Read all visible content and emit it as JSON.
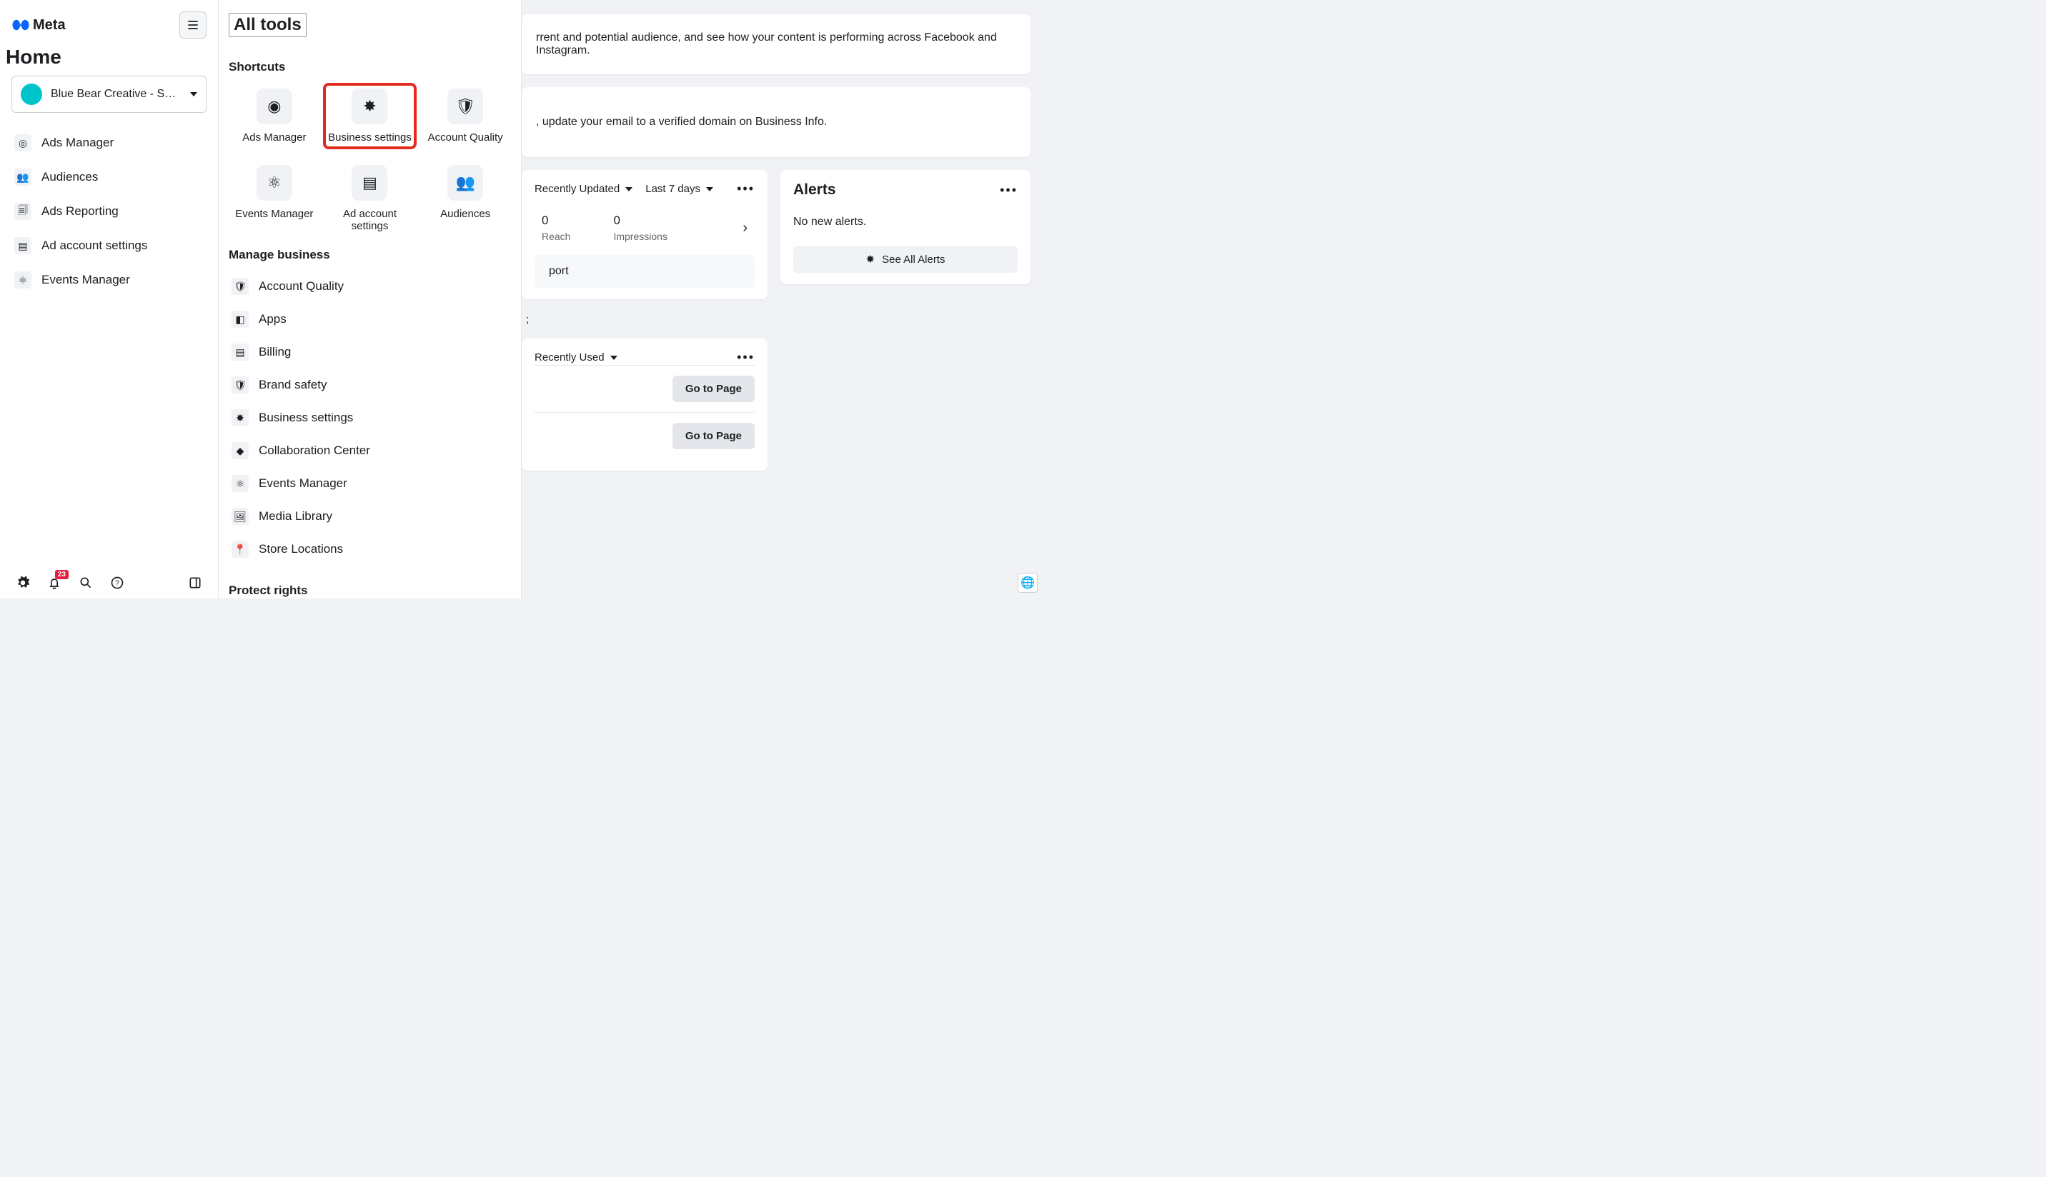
{
  "sidebar": {
    "logo_text": "Meta",
    "home_title": "Home",
    "account_name": "Blue Bear Creative - Soc...",
    "nav": [
      {
        "label": "Ads Manager"
      },
      {
        "label": "Audiences"
      },
      {
        "label": "Ads Reporting"
      },
      {
        "label": "Ad account settings"
      },
      {
        "label": "Events Manager"
      }
    ],
    "notification_count": "23"
  },
  "all_tools": {
    "title": "All tools",
    "shortcuts_heading": "Shortcuts",
    "shortcuts": [
      {
        "label": "Ads Manager"
      },
      {
        "label": "Business settings"
      },
      {
        "label": "Account Quality"
      },
      {
        "label": "Events Manager"
      },
      {
        "label": "Ad account settings"
      },
      {
        "label": "Audiences"
      }
    ],
    "manage_heading": "Manage business",
    "manage_items": [
      {
        "label": "Account Quality"
      },
      {
        "label": "Apps"
      },
      {
        "label": "Billing"
      },
      {
        "label": "Brand safety"
      },
      {
        "label": "Business settings"
      },
      {
        "label": "Collaboration Center"
      },
      {
        "label": "Events Manager"
      },
      {
        "label": "Media Library"
      },
      {
        "label": "Store Locations"
      }
    ],
    "protect_heading": "Protect rights"
  },
  "main": {
    "banner1_text": "rrent and potential audience, and see how your content is performing across Facebook and Instagram.",
    "banner2_text": ", update your email to a verified domain on Business Info.",
    "stats_card": {
      "filter1": "Recently Updated",
      "filter2": "Last 7 days",
      "reach_value": "0",
      "reach_label": "Reach",
      "impressions_value": "0",
      "impressions_label": "Impressions",
      "port_label": "port"
    },
    "stray_semicolon": ";",
    "pages_card": {
      "filter": "Recently Used",
      "go_label": "Go to Page"
    },
    "alerts_card": {
      "title": "Alerts",
      "body": "No new alerts.",
      "button": "See All Alerts"
    }
  }
}
